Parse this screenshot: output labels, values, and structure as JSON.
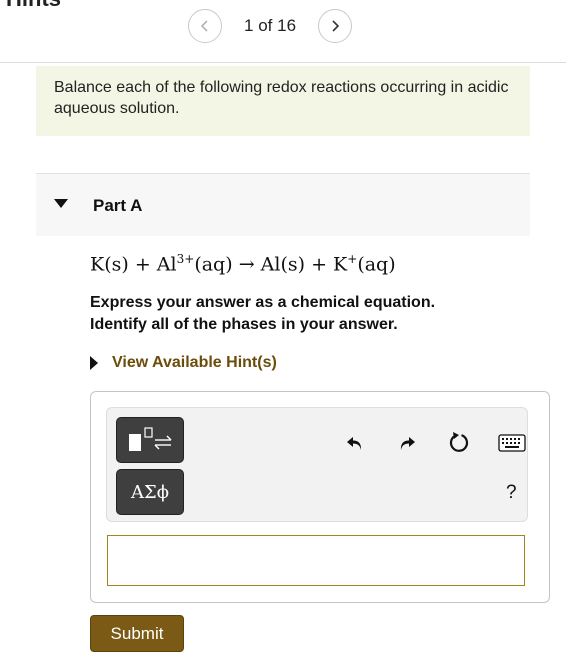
{
  "header": {
    "cut_title": "Hints"
  },
  "pager": {
    "prev_icon": "chevron-left-icon",
    "next_icon": "chevron-right-icon",
    "current": "1",
    "of_label": "of",
    "total": "16"
  },
  "instructions": {
    "text": "Balance each of the following redox reactions occurring in acidic aqueous solution."
  },
  "part": {
    "title": "Part A",
    "equation": {
      "a": "K(s)",
      "plus1": "+",
      "b": "Al",
      "b_charge": "3+",
      "b_phase": "(aq)",
      "arrow": "→",
      "c": "Al(s)",
      "plus2": "+",
      "d": "K",
      "d_charge": "+",
      "d_phase": "(aq)"
    },
    "express_line1": "Express your answer as a chemical equation.",
    "express_line2": "Identify all of the phases in your answer.",
    "hint_label": "View Available Hint(s)"
  },
  "toolbar": {
    "template_icon": "chemistry-template-icon",
    "symbols_label": "ΑΣϕ",
    "undo_icon": "undo-icon",
    "redo_icon": "redo-icon",
    "reset_icon": "reset-icon",
    "keyboard_icon": "keyboard-icon",
    "help_label": "?"
  },
  "answer": {
    "value": ""
  },
  "submit_label": "Submit",
  "colors": {
    "accent": "#7a5a14",
    "hint_text": "#6b4c0a",
    "instructions_bg": "#f3f6e4",
    "input_border": "#a3861e"
  }
}
